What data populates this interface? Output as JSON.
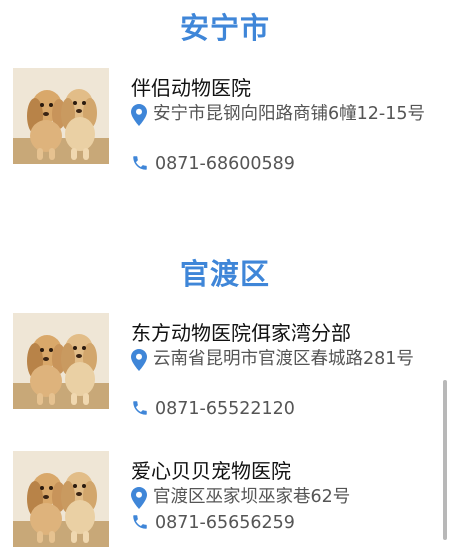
{
  "sections": [
    {
      "title": "安宁市",
      "entries": [
        {
          "name": "伴侣动物医院",
          "address": "安宁市昆钢向阳路商铺6幢12-15号",
          "phone": "0871-68600589",
          "photo_icon": "puppies-photo"
        }
      ]
    },
    {
      "title": "官渡区",
      "entries": [
        {
          "name": "东方动物医院佴家湾分部",
          "address": "云南省昆明市官渡区春城路281号",
          "phone": "0871-65522120",
          "photo_icon": "puppies-photo"
        },
        {
          "name": "爱心贝贝宠物医院",
          "address": "官渡区巫家坝巫家巷62号",
          "phone": "0871-65656259",
          "photo_icon": "puppies-photo"
        }
      ]
    }
  ],
  "icons": {
    "address": "location-pin-icon",
    "phone": "phone-icon"
  },
  "colors": {
    "accent": "#3f86d8",
    "text_primary": "#111111",
    "text_secondary": "#555555"
  }
}
